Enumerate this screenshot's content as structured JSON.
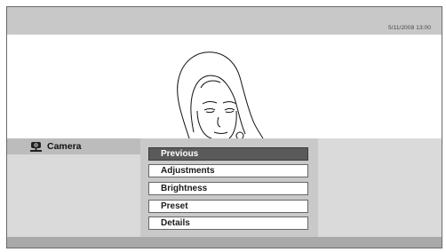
{
  "status": {
    "datetime": "5/11/2008 13:00"
  },
  "camera_panel": {
    "label": "Camera",
    "icon": "camera-icon"
  },
  "menu": {
    "items": [
      {
        "label": "Previous",
        "selected": true
      },
      {
        "label": "Adjustments",
        "selected": false
      },
      {
        "label": "Brightness",
        "selected": false
      },
      {
        "label": "Preset",
        "selected": false
      },
      {
        "label": "Details",
        "selected": false
      }
    ]
  },
  "colors": {
    "top_bar": "#c8c8c8",
    "panel_bg": "#dadada",
    "menu_bg": "#c9c9c9",
    "selected_item": "#5a5a5a"
  }
}
